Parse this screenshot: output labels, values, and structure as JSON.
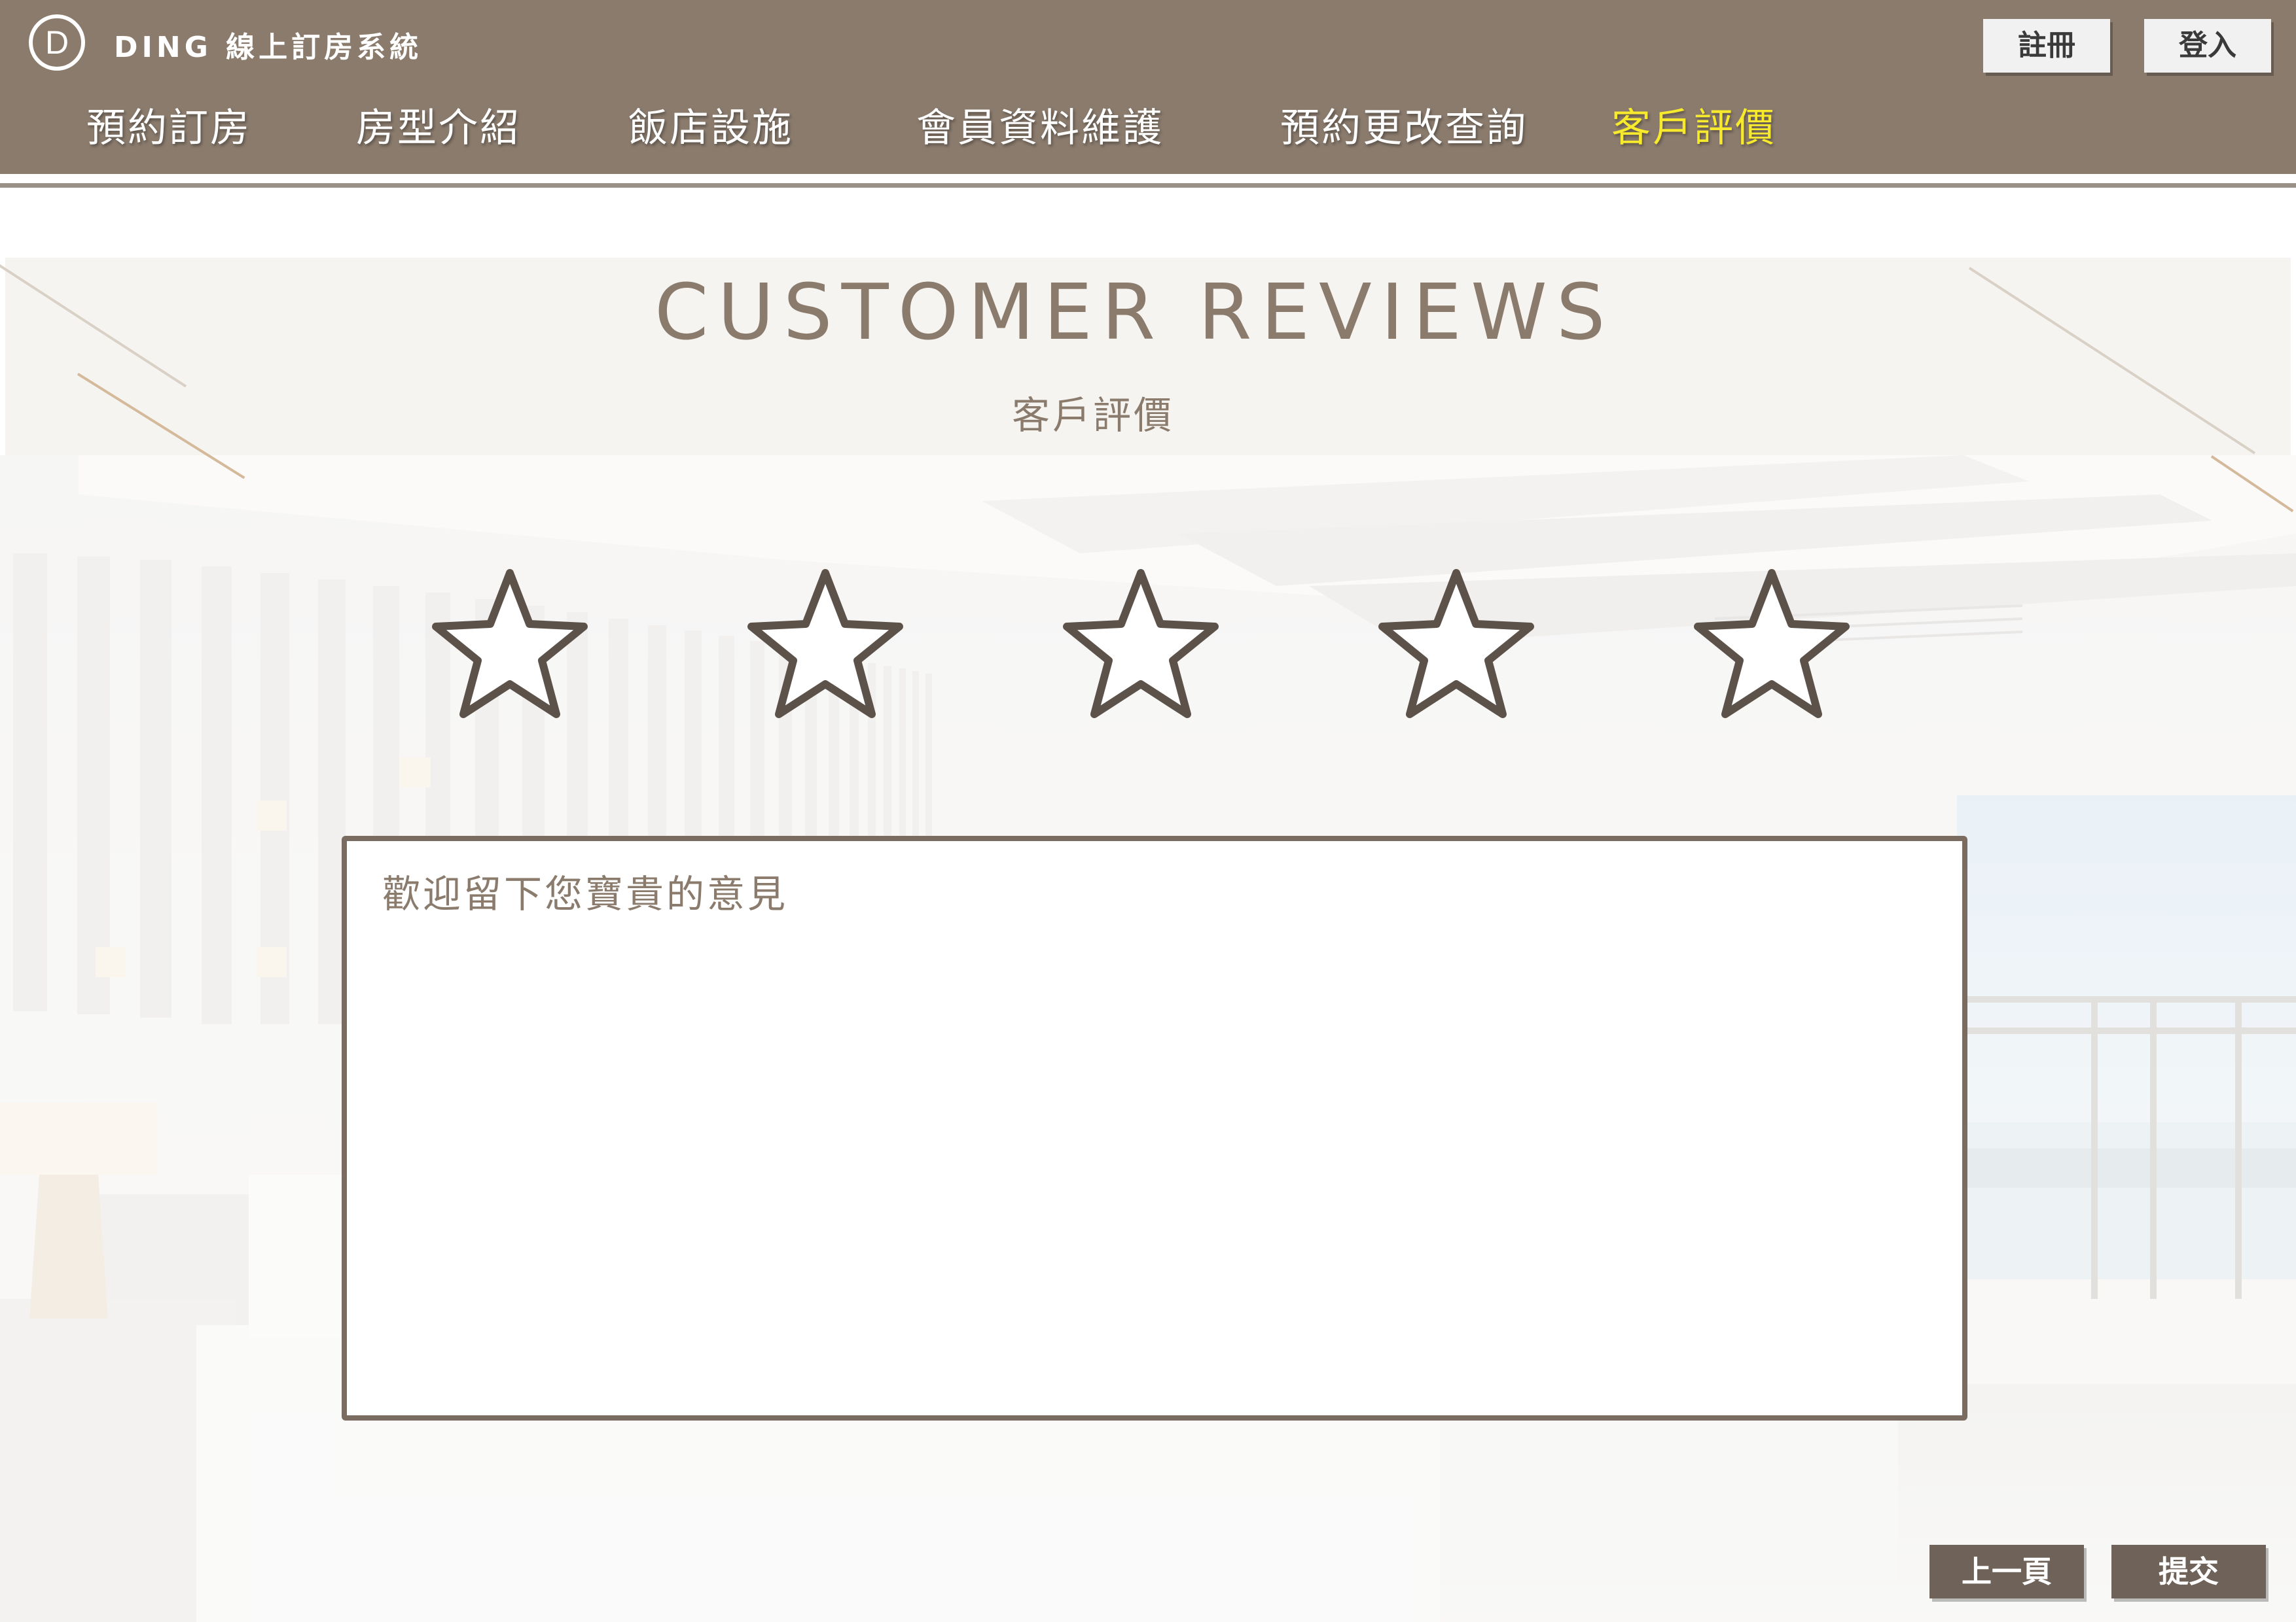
{
  "header": {
    "logo_letter": "D",
    "brand": "DING 線上訂房系統",
    "register_label": "註冊",
    "login_label": "登入"
  },
  "nav": {
    "items": [
      {
        "label": "預約訂房"
      },
      {
        "label": "房型介紹"
      },
      {
        "label": "飯店設施"
      },
      {
        "label": "會員資料維護"
      },
      {
        "label": "預約更改查詢"
      },
      {
        "label": "客戶評價",
        "active": true
      }
    ]
  },
  "main": {
    "title_en": "CUSTOMER REVIEWS",
    "title_zh": "客戶評價",
    "rating": {
      "value": 0,
      "max": 5,
      "icon": "star-outline-icon"
    },
    "review": {
      "placeholder": "歡迎留下您寶貴的意見",
      "value": ""
    }
  },
  "footer": {
    "back_label": "上一頁",
    "submit_label": "提交"
  },
  "colors": {
    "header_bg": "#8a7b6d",
    "active_nav": "#f7e92b",
    "accent_text": "#8a7b6d",
    "button_dark": "#6f6258",
    "star_stroke": "#5c524a"
  }
}
